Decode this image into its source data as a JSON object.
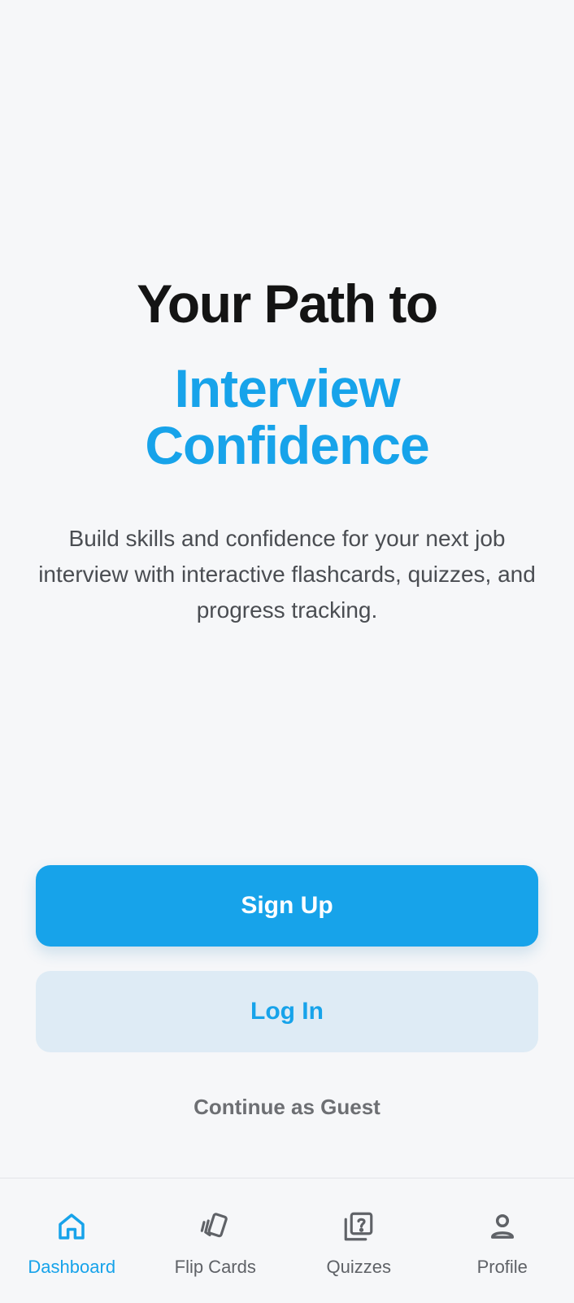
{
  "hero": {
    "title_line1": "Your Path to",
    "title_line2": "Interview Confidence",
    "subtitle": "Build skills and confidence for your next job interview with interactive flashcards, quizzes, and progress tracking."
  },
  "actions": {
    "signup_label": "Sign Up",
    "login_label": "Log In",
    "guest_label": "Continue as Guest"
  },
  "tabbar": {
    "items": [
      {
        "label": "Dashboard",
        "icon": "home-icon",
        "active": true
      },
      {
        "label": "Flip Cards",
        "icon": "flip-cards-icon",
        "active": false
      },
      {
        "label": "Quizzes",
        "icon": "quiz-icon",
        "active": false
      },
      {
        "label": "Profile",
        "icon": "person-icon",
        "active": false
      }
    ]
  },
  "colors": {
    "accent": "#17a3ea",
    "background": "#f6f7f9",
    "login_bg": "#deebf5",
    "title": "#141414",
    "inactive": "#5f6267"
  }
}
